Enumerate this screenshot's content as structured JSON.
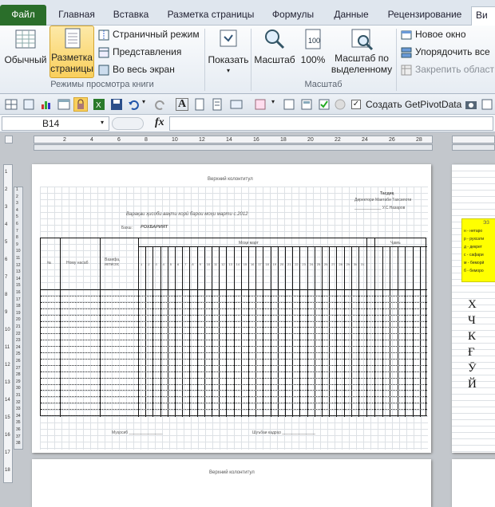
{
  "tabs": {
    "file": "Файл",
    "home": "Главная",
    "insert": "Вставка",
    "page_layout": "Разметка страницы",
    "formulas": "Формулы",
    "data": "Данные",
    "review": "Рецензирование",
    "view": "Ви"
  },
  "ribbon": {
    "normal": "Обычный",
    "page_layout_line1": "Разметка",
    "page_layout_line2": "страницы",
    "page_break": "Страничный режим",
    "custom_views": "Представления",
    "full_screen": "Во весь экран",
    "group_views": "Режимы просмотра книги",
    "show": "Показать",
    "zoom": "Масштаб",
    "zoom100": "100%",
    "zoom_sel_line1": "Масштаб по",
    "zoom_sel_line2": "выделенному",
    "group_zoom": "Масштаб",
    "new_window": "Новое окно",
    "arrange_all": "Упорядочить все",
    "freeze": "Закрепить област"
  },
  "qat": {
    "pivot_label": "Создать GetPivotData"
  },
  "formula_bar": {
    "name_box": "B14",
    "fx": "fx"
  },
  "ruler": {
    "top_numbers": [
      "2",
      "4",
      "6",
      "8",
      "10",
      "12",
      "14",
      "16",
      "18",
      "20",
      "22",
      "24",
      "26",
      "28"
    ],
    "left_numbers": [
      "1",
      "2",
      "3",
      "4",
      "5",
      "6",
      "7",
      "8",
      "9",
      "10",
      "11",
      "12",
      "13",
      "14",
      "15",
      "16",
      "17",
      "18"
    ],
    "row_numbers": [
      "1",
      "2",
      "3",
      "4",
      "5",
      "6",
      "7",
      "8",
      "9",
      "10",
      "11",
      "12",
      "13",
      "14",
      "15",
      "16",
      "17",
      "18",
      "19",
      "20",
      "21",
      "22",
      "23",
      "24",
      "25",
      "26",
      "27",
      "28",
      "29",
      "30",
      "31",
      "32",
      "33",
      "34",
      "35",
      "36",
      "37",
      "38"
    ]
  },
  "page1": {
    "header": "Верхний колонтитул",
    "approve_title": "Тасдиқ",
    "approve_line1": "Директори Мактаби Тахсилоти",
    "approve_line2": "____________ У.С.Назаров",
    "doc_title": "Варақаи ҳисоби вақти корӣ барои моҳи марти с.2012",
    "dept_label": "Бахш:",
    "dept_value": "РОХБАРИЯТ",
    "col_no": "№",
    "col_name": "Ному насаб",
    "col_pos": "Вазифа, ихтисос",
    "col_days": "Моҳи март",
    "col_sum": "Ҷамъ"
  },
  "page2": {
    "header": "Верхний колонтитул"
  },
  "right_page": {
    "legend_title": "ЭЗ",
    "legend": [
      "н - нетаро",
      "р - рухсати",
      "д - декрет",
      "с - сафари",
      "м - беморӣ",
      "б - беморо"
    ],
    "letters": [
      "Х",
      "Ч",
      "К",
      "Ғ",
      "Ӯ",
      "Й"
    ]
  },
  "colors": {
    "file_tab": "#2a6e2a",
    "legend_bg": "#ffff00",
    "active_button": "#f9cf5c"
  }
}
